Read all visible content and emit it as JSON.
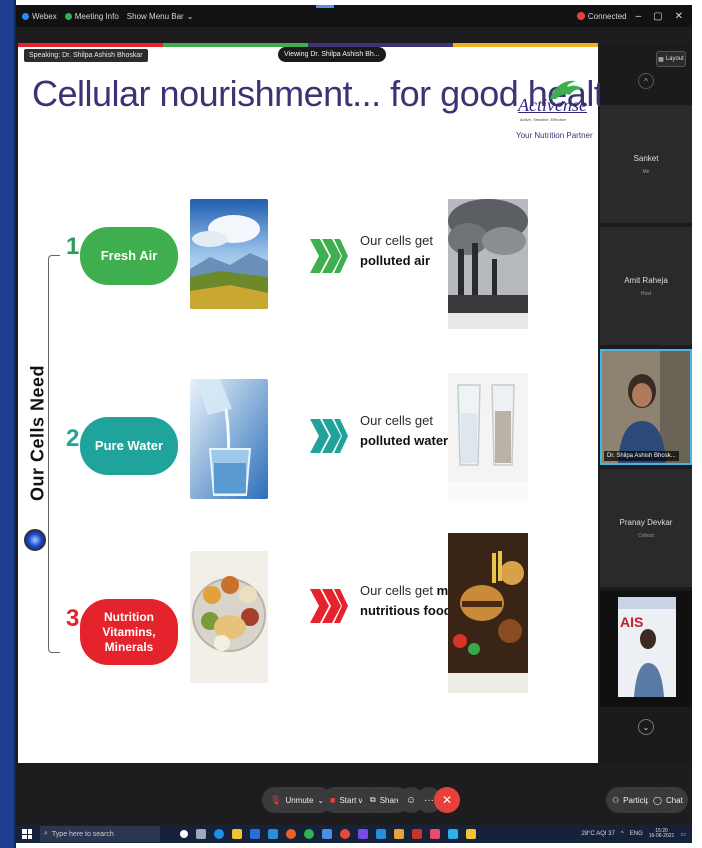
{
  "titlebar": {
    "app": "Webex",
    "meeting_info": "Meeting Info",
    "show_menu": "Show Menu Bar",
    "connected": "Connected",
    "minimize": "–",
    "restore": "▢",
    "close": "✕"
  },
  "meeting": {
    "speaking": "Speaking: Dr. Shilpa Ashish Bhoskar",
    "viewing": "Viewing Dr. Shilpa Ashish Bh..."
  },
  "slide": {
    "title": "Cellular nourishment... for good health",
    "brand": "Activense",
    "brand_tag": "Active. Sensible. Effective",
    "partner": "Your Nutrition Partner",
    "vertical_title": "Our Cells Need",
    "rows": [
      {
        "num": "1",
        "label": "Fresh Air",
        "result_line1": "Our cells get",
        "result_bold": "polluted air"
      },
      {
        "num": "2",
        "label": "Pure Water",
        "result_line1": "Our cells get",
        "result_bold": "polluted water"
      },
      {
        "num": "3",
        "label": "Nutrition Vitamins, Minerals",
        "result_line1": "Our cells get",
        "result_bold_inline": "mal-",
        "result_bold": "nutritious food"
      }
    ]
  },
  "panel": {
    "layout": "Layout",
    "participants": [
      {
        "name": "Sanket",
        "sub": "Me"
      },
      {
        "name": "Amit Raheja",
        "sub": "Host"
      },
      {
        "name": "Dr. Shilpa Ashish Bhosk..."
      },
      {
        "name": "Pranay Devkar",
        "sub": "Cohost"
      }
    ],
    "thumb_text": "AIS"
  },
  "controls": {
    "unmute": "Unmute",
    "start_video": "Start video",
    "share": "Share",
    "participants": "Participants",
    "chat": "Chat",
    "more": "···"
  },
  "taskbar": {
    "search": "Type here to search",
    "weather": "28°C AQI 37",
    "lang": "ENG",
    "time": "15:20",
    "date": "16-06-2021"
  },
  "colors": {
    "pill_green": "#3fae4f",
    "pill_teal": "#1fa39a",
    "pill_red": "#e4232d",
    "title_purple": "#3b3374"
  }
}
